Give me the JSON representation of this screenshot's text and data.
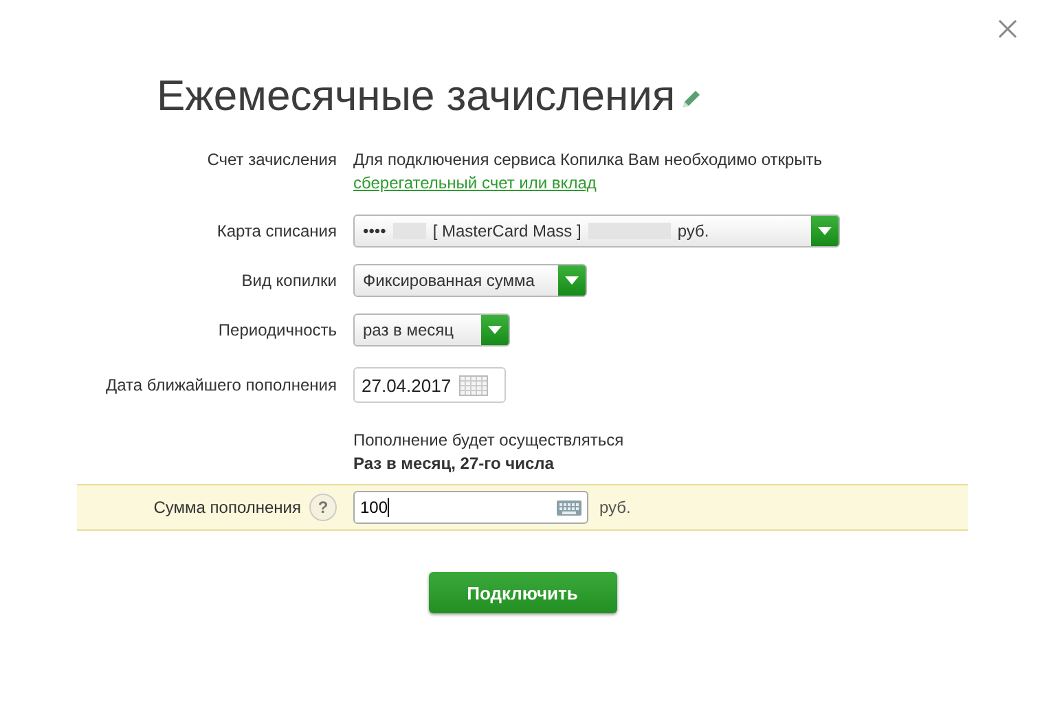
{
  "title": "Ежемесячные зачисления",
  "account": {
    "label": "Счет зачисления",
    "text": "Для подключения сервиса Копилка Вам необходимо открыть",
    "link": "сберегательный счет или вклад"
  },
  "card": {
    "label": "Карта списания",
    "prefix": "••••",
    "name": "[ MasterCard Mass ]",
    "currency": "руб."
  },
  "type": {
    "label": "Вид копилки",
    "value": "Фиксированная сумма"
  },
  "period": {
    "label": "Периодичность",
    "value": "раз в месяц"
  },
  "date": {
    "label": "Дата ближайшего пополнения",
    "value": "27.04.2017"
  },
  "schedule": {
    "text": "Пополнение будет осуществляться",
    "detail": "Раз в месяц, 27-го числа"
  },
  "amount": {
    "label": "Сумма пополнения",
    "help": "?",
    "value": "100",
    "currency": "руб.",
    "highlighted": true
  },
  "submit": "Подключить"
}
